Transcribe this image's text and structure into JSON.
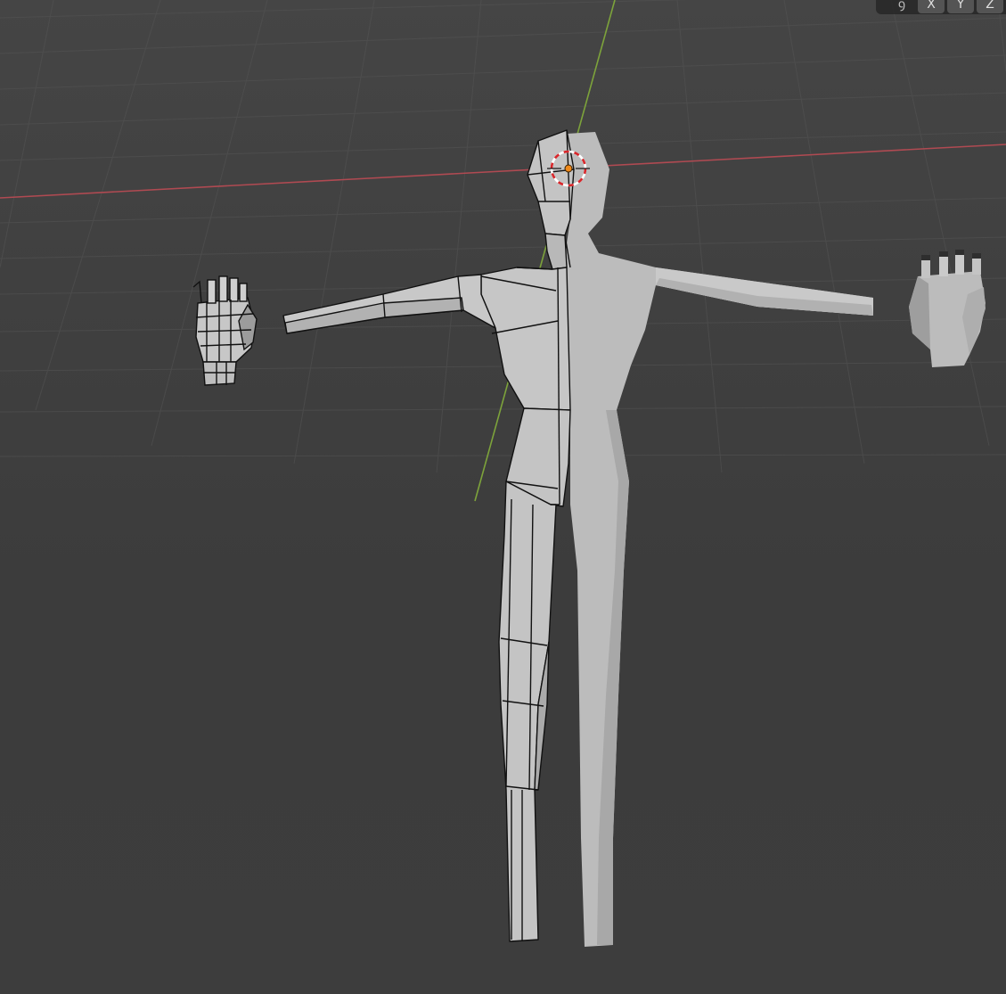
{
  "toolbar": {
    "mirror_icon": "mirror-icon",
    "mirror_glyph": "ꝯ",
    "axes": [
      {
        "label": "X"
      },
      {
        "label": "Y"
      },
      {
        "label": "Z"
      }
    ]
  },
  "colors": {
    "background": "#3d3d3d",
    "grid": "#555555",
    "x_axis": "#b04a52",
    "y_axis": "#7da33b",
    "mesh_light": "#bdbdbd",
    "mesh_shade": "#a7a7a7",
    "wire": "#111111",
    "origin": "#f08a1c",
    "cursor_red": "#d8262a"
  }
}
